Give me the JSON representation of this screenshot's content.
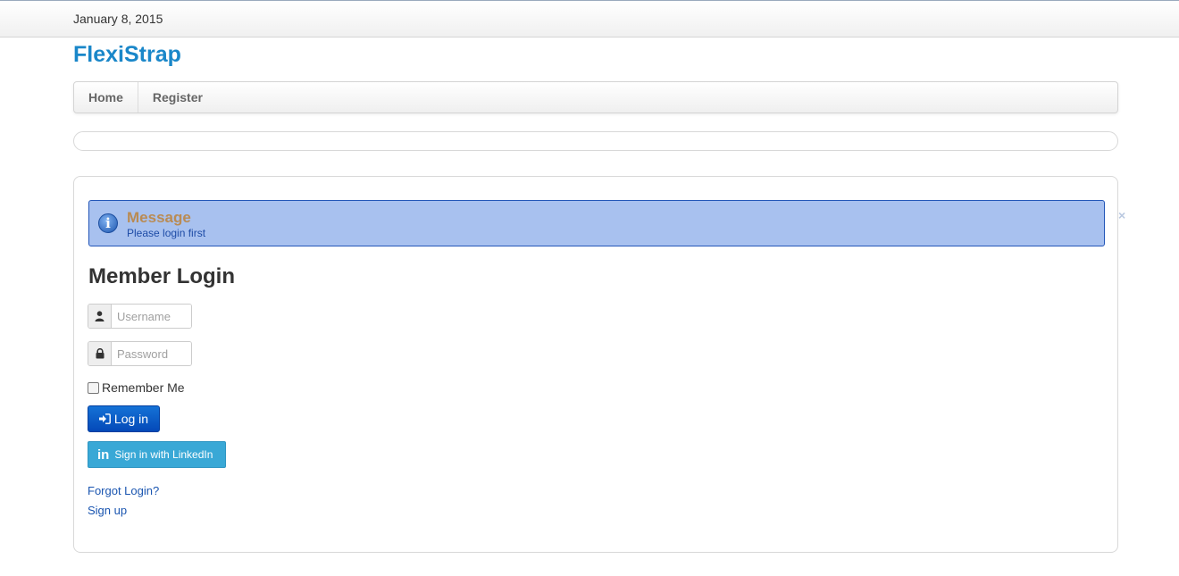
{
  "header": {
    "date": "January 8, 2015"
  },
  "brand": {
    "name": "FlexiStrap",
    "color": "#1a87c9"
  },
  "nav": {
    "items": [
      {
        "label": "Home"
      },
      {
        "label": "Register"
      }
    ]
  },
  "alert": {
    "title": "Message",
    "text": "Please login first",
    "icon": "info-icon",
    "close_label": "×"
  },
  "login": {
    "title": "Member Login",
    "username": {
      "placeholder": "Username",
      "value": "",
      "icon": "user-icon"
    },
    "password": {
      "placeholder": "Password",
      "value": "",
      "icon": "lock-icon"
    },
    "remember_label": "Remember Me",
    "remember_checked": false,
    "login_button": "Log in",
    "linkedin_button": "Sign in with LinkedIn",
    "links": [
      {
        "label": "Forgot Login?"
      },
      {
        "label": "Sign up"
      }
    ]
  },
  "colors": {
    "primary_button": "#0a5bc8",
    "linkedin": "#39a8d6",
    "alert_bg": "#a8c1ef",
    "link": "#1a55b0"
  }
}
